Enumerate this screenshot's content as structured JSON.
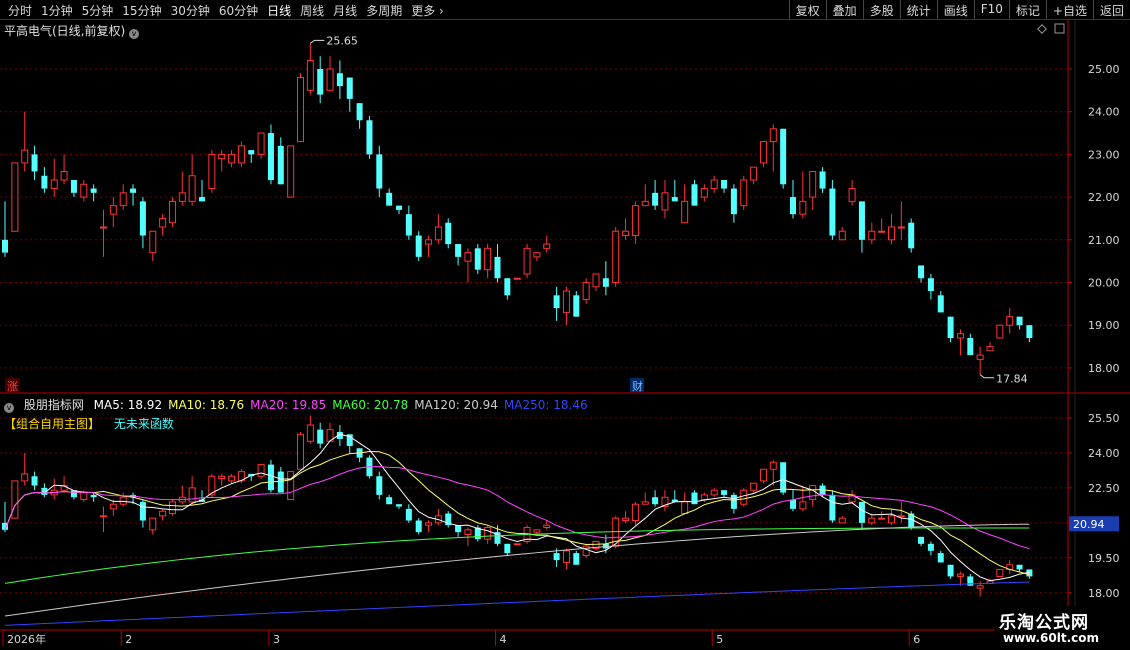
{
  "toolbar": {
    "periods": [
      "分时",
      "1分钟",
      "5分钟",
      "15分钟",
      "30分钟",
      "60分钟",
      "日线",
      "周线",
      "月线",
      "多周期",
      "更多"
    ],
    "active_period": "日线",
    "tools": [
      "复权",
      "叠加",
      "多股",
      "统计",
      "画线",
      "F10",
      "标记",
      "+自选",
      "返回"
    ]
  },
  "stock": {
    "title": "平高电气(日线,前复权)",
    "high_label": "25.65",
    "low_label": "17.84",
    "marker_zhang": "涨",
    "marker_cai": "财"
  },
  "indicator": {
    "name": "股朋指标网",
    "ma": [
      {
        "label": "MA5: 18.92",
        "color": "#ffffff"
      },
      {
        "label": "MA10: 18.76",
        "color": "#ffff66"
      },
      {
        "label": "MA20: 19.85",
        "color": "#ff44ff"
      },
      {
        "label": "MA60: 20.78",
        "color": "#44ff44"
      },
      {
        "label": "MA120: 20.94",
        "color": "#cccccc"
      },
      {
        "label": "MA250: 18.46",
        "color": "#3344ff"
      }
    ],
    "formula": "【组合自用主图】",
    "future": "无未来函数",
    "price_tag": "20.94"
  },
  "axes": {
    "upper_ticks": [
      "25.00",
      "24.00",
      "23.00",
      "22.00",
      "21.00",
      "20.00",
      "19.00",
      "18.00"
    ],
    "lower_ticks": [
      "25.50",
      "24.00",
      "22.50",
      "21.00",
      "19.50",
      "18.00"
    ],
    "month_labels": [
      "2026年",
      "2",
      "3",
      "4",
      "5",
      "6"
    ]
  },
  "logo": {
    "title": "乐淘公式网",
    "url": "www.60lt.com"
  },
  "chart_data": {
    "type": "candlestick",
    "candles": [
      [
        21.0,
        20.7,
        21.9,
        20.6
      ],
      [
        21.2,
        22.8,
        22.8,
        21.2
      ],
      [
        22.8,
        23.1,
        24.0,
        22.6
      ],
      [
        23.0,
        22.6,
        23.2,
        22.4
      ],
      [
        22.5,
        22.2,
        22.7,
        22.1
      ],
      [
        22.2,
        22.4,
        22.9,
        22.0
      ],
      [
        22.4,
        22.6,
        23.0,
        22.3
      ],
      [
        22.4,
        22.1,
        22.4,
        22.0
      ],
      [
        22.0,
        22.3,
        22.4,
        21.9
      ],
      [
        22.2,
        22.1,
        22.3,
        21.9
      ],
      [
        21.3,
        21.3,
        21.7,
        20.6
      ],
      [
        21.6,
        21.8,
        22.0,
        21.3
      ],
      [
        21.8,
        22.1,
        22.3,
        21.7
      ],
      [
        22.2,
        22.1,
        22.3,
        21.8
      ],
      [
        21.9,
        21.1,
        22.0,
        20.8
      ],
      [
        20.7,
        21.2,
        21.2,
        20.5
      ],
      [
        21.3,
        21.5,
        21.6,
        21.1
      ],
      [
        21.4,
        21.9,
        22.0,
        21.3
      ],
      [
        21.9,
        22.1,
        22.6,
        21.8
      ],
      [
        21.9,
        22.5,
        23.0,
        21.8
      ],
      [
        22.0,
        21.9,
        22.4,
        21.9
      ],
      [
        22.2,
        23.0,
        23.1,
        22.1
      ],
      [
        22.9,
        23.0,
        23.1,
        22.6
      ],
      [
        22.8,
        23.0,
        23.1,
        22.7
      ],
      [
        22.8,
        23.2,
        23.3,
        22.7
      ],
      [
        23.1,
        23.0,
        23.1,
        22.8
      ],
      [
        23.0,
        23.5,
        23.5,
        22.9
      ],
      [
        23.5,
        22.4,
        23.7,
        22.3
      ],
      [
        23.2,
        22.3,
        23.4,
        22.3
      ],
      [
        22.0,
        23.2,
        23.2,
        22.0
      ],
      [
        23.3,
        24.8,
        24.9,
        23.3
      ],
      [
        24.5,
        25.2,
        25.6,
        24.4
      ],
      [
        25.0,
        24.4,
        25.3,
        24.2
      ],
      [
        24.5,
        25.0,
        25.3,
        24.5
      ],
      [
        24.9,
        24.6,
        25.2,
        24.3
      ],
      [
        24.8,
        24.3,
        24.8,
        24.0
      ],
      [
        24.2,
        23.8,
        24.2,
        23.6
      ],
      [
        23.8,
        23.0,
        23.9,
        22.9
      ],
      [
        23.0,
        22.2,
        23.2,
        22.0
      ],
      [
        22.1,
        21.8,
        22.2,
        21.8
      ],
      [
        21.8,
        21.7,
        21.8,
        21.6
      ],
      [
        21.6,
        21.1,
        21.8,
        21.0
      ],
      [
        21.1,
        20.6,
        21.2,
        20.5
      ],
      [
        20.9,
        21.0,
        21.1,
        20.6
      ],
      [
        21.0,
        21.3,
        21.6,
        20.9
      ],
      [
        21.4,
        20.9,
        21.5,
        20.8
      ],
      [
        20.9,
        20.6,
        20.9,
        20.4
      ],
      [
        20.5,
        20.7,
        20.8,
        20.0
      ],
      [
        20.8,
        20.3,
        20.9,
        20.2
      ],
      [
        20.3,
        20.8,
        20.9,
        20.1
      ],
      [
        20.6,
        20.1,
        20.9,
        20.0
      ],
      [
        20.1,
        19.7,
        20.1,
        19.6
      ],
      [
        20.1,
        20.1,
        20.1,
        20.1
      ],
      [
        20.2,
        20.8,
        20.9,
        20.1
      ],
      [
        20.6,
        20.7,
        20.7,
        20.5
      ],
      [
        20.8,
        20.9,
        21.1,
        20.7
      ],
      [
        19.7,
        19.4,
        19.9,
        19.1
      ],
      [
        19.3,
        19.8,
        19.9,
        19.0
      ],
      [
        19.7,
        19.2,
        19.8,
        19.2
      ],
      [
        19.6,
        20.0,
        20.1,
        19.5
      ],
      [
        19.9,
        20.2,
        20.2,
        19.8
      ],
      [
        20.1,
        19.9,
        20.5,
        19.7
      ],
      [
        20.0,
        21.2,
        21.3,
        19.9
      ],
      [
        21.1,
        21.2,
        21.5,
        21.0
      ],
      [
        21.1,
        21.8,
        21.9,
        20.9
      ],
      [
        21.8,
        21.9,
        22.3,
        21.8
      ],
      [
        22.1,
        21.8,
        22.4,
        21.7
      ],
      [
        21.7,
        22.1,
        22.4,
        21.5
      ],
      [
        22.0,
        21.9,
        22.4,
        21.9
      ],
      [
        21.4,
        21.9,
        22.3,
        21.4
      ],
      [
        22.3,
        21.8,
        22.4,
        21.8
      ],
      [
        22.0,
        22.2,
        22.3,
        21.9
      ],
      [
        22.2,
        22.4,
        22.5,
        22.1
      ],
      [
        22.4,
        22.2,
        22.4,
        22.1
      ],
      [
        22.2,
        21.6,
        22.3,
        21.4
      ],
      [
        21.8,
        22.4,
        22.5,
        21.7
      ],
      [
        22.4,
        22.7,
        22.7,
        22.3
      ],
      [
        22.8,
        23.3,
        23.3,
        22.7
      ],
      [
        23.3,
        23.6,
        23.7,
        22.6
      ],
      [
        23.6,
        22.3,
        23.6,
        22.2
      ],
      [
        22.0,
        21.6,
        22.4,
        21.5
      ],
      [
        21.6,
        21.9,
        22.6,
        21.5
      ],
      [
        22.0,
        22.6,
        22.6,
        21.7
      ],
      [
        22.6,
        22.2,
        22.7,
        22.1
      ],
      [
        22.2,
        21.1,
        22.4,
        21.0
      ],
      [
        21.0,
        21.2,
        21.3,
        21.0
      ],
      [
        21.9,
        22.2,
        22.4,
        21.8
      ],
      [
        21.9,
        21.0,
        21.9,
        20.7
      ],
      [
        21.0,
        21.2,
        21.4,
        20.9
      ],
      [
        21.2,
        21.2,
        21.5,
        21.2
      ],
      [
        21.0,
        21.3,
        21.6,
        20.9
      ],
      [
        21.3,
        21.3,
        21.9,
        21.0
      ],
      [
        21.4,
        20.8,
        21.5,
        20.7
      ],
      [
        20.4,
        20.1,
        20.4,
        20.0
      ],
      [
        20.1,
        19.8,
        20.2,
        19.6
      ],
      [
        19.7,
        19.3,
        19.8,
        19.3
      ],
      [
        19.2,
        18.7,
        19.2,
        18.6
      ],
      [
        18.7,
        18.8,
        18.9,
        18.3
      ],
      [
        18.7,
        18.3,
        18.8,
        18.3
      ],
      [
        18.2,
        18.3,
        18.5,
        17.84
      ],
      [
        18.4,
        18.5,
        18.6,
        18.4
      ],
      [
        18.7,
        19.0,
        19.0,
        18.7
      ],
      [
        19.0,
        19.2,
        19.4,
        18.8
      ],
      [
        19.2,
        19.0,
        19.2,
        18.9
      ],
      [
        19.0,
        18.7,
        19.0,
        18.6
      ]
    ]
  }
}
